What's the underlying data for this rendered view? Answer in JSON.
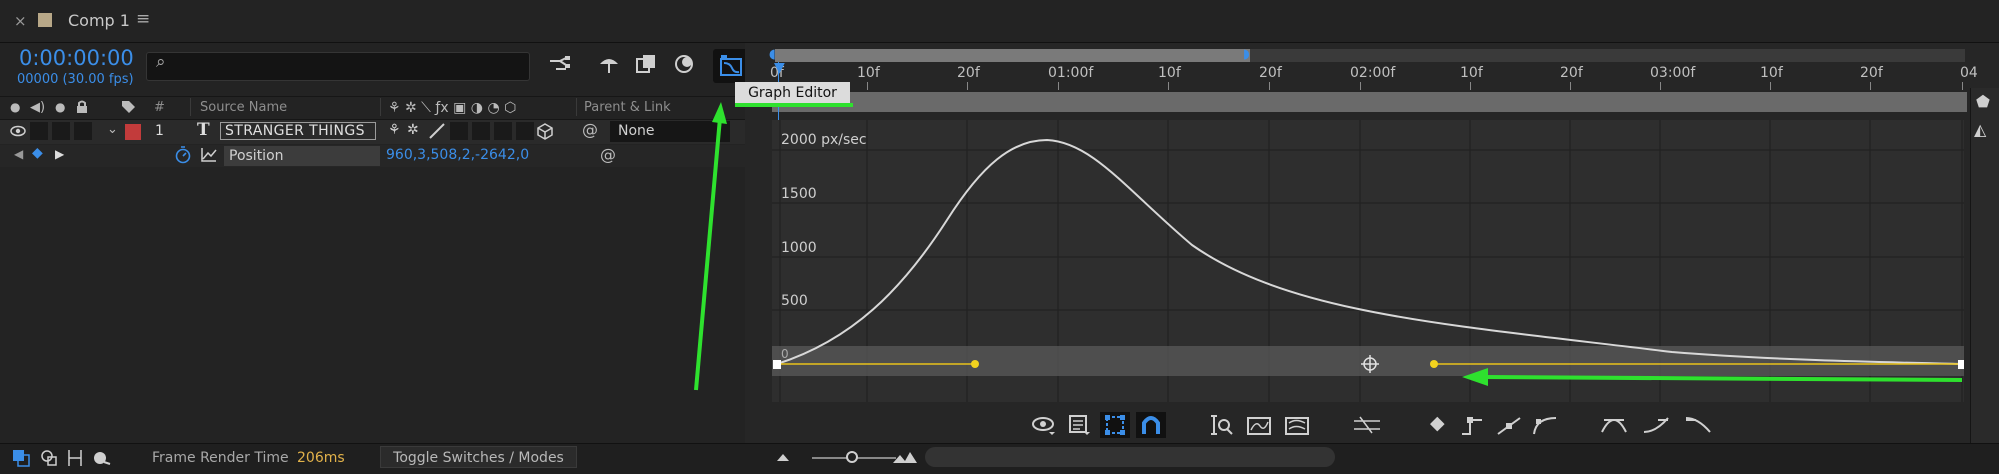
{
  "tab": {
    "close_icon": "×",
    "title": "Comp 1",
    "menu_icon": "≡"
  },
  "composition": {
    "timecode": "0:00:00:00",
    "frame_info": "00000 (30.00 fps)",
    "search_icon": "⌕",
    "search_placeholder": ""
  },
  "columns": {
    "hash": "#",
    "source_name": "Source Name",
    "parent_link": "Parent & Link"
  },
  "layer": {
    "number": "1",
    "type_icon": "T",
    "name": "STRANGER THINGS",
    "parent": "None",
    "label_color": "#c23b3b"
  },
  "property": {
    "name": "Position",
    "value": "960,3,508,2,-2642,0"
  },
  "tooltip": {
    "text": "Graph Editor"
  },
  "ruler": {
    "labels": [
      "0f",
      "10f",
      "20f",
      "01:00f",
      "10f",
      "20f",
      "02:00f",
      "10f",
      "20f",
      "03:00f",
      "10f",
      "20f",
      "04"
    ]
  },
  "graph": {
    "y_labels": [
      "2000 px/sec",
      "1500",
      "1000",
      "500",
      "0"
    ]
  },
  "status": {
    "frame_render_label": "Frame Render Time",
    "frame_render_value": "206ms",
    "toggle_label": "Toggle Switches / Modes"
  },
  "colors": {
    "accent": "#3b8ee8",
    "annotation": "#2ee12e",
    "curve": "#d8d8d8",
    "speed_line": "#e8c21a"
  }
}
